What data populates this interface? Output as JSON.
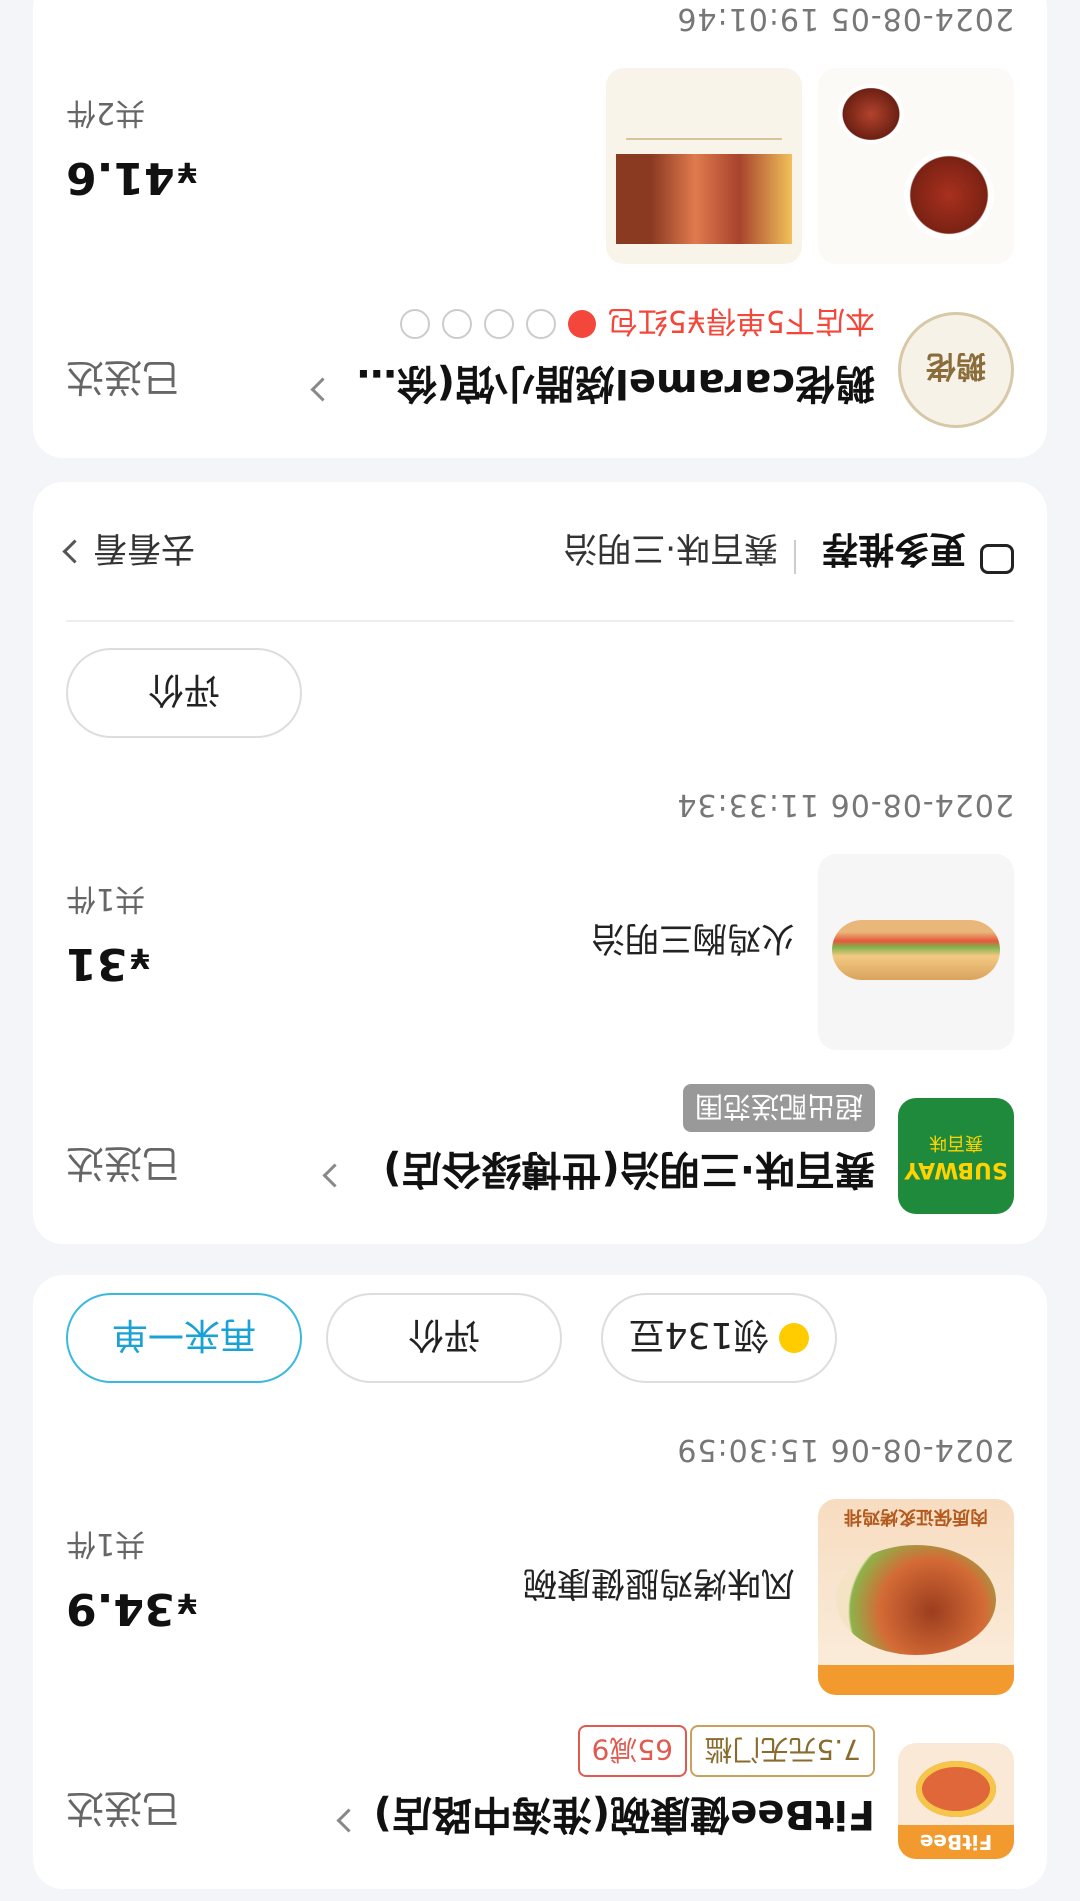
{
  "orders": [
    {
      "shop_name": "FitBee健康碗(淮海中路店)",
      "status": "已送达",
      "tags": [
        "7.5元无门槛",
        "65减9"
      ],
      "logo_text": "FitBee",
      "item_name": "风味烤鸡腿健康碗",
      "thumb_text": "肉质保证炙烤鸡排",
      "price_symbol": "¥",
      "price": "34.9",
      "count": "共1件",
      "time": "2024-08-06 15:30:59",
      "buttons": {
        "bean": "领134豆",
        "review": "评价",
        "reorder": "再来一单"
      }
    },
    {
      "shop_name": "赛百味·三明治(世博绿谷店)",
      "status": "已送达",
      "badge": "超出配送范围",
      "logo_text": "SUBWAY",
      "logo_sub": "赛百味",
      "item_name": "火鸡胸三明治",
      "price_symbol": "¥",
      "price": "31",
      "count": "共1件",
      "time": "2024-08-06 11:33:34",
      "buttons": {
        "review": "评价"
      },
      "recommend": {
        "title": "更多推荐",
        "shop": "赛百味·三明治",
        "link": "去看看"
      }
    },
    {
      "shop_name": "鹅佬caramel烧腊小馆(徐家…",
      "status": "已送达",
      "promo": "本店下5单得¥5红包",
      "logo_text": "鹅佬",
      "price_symbol": "¥",
      "price": "41.6",
      "count": "共2件",
      "time": "2024-08-05 19:01:46"
    }
  ],
  "colors": {
    "accent": "#1aa2d4",
    "promo_red": "#f2473a",
    "tag_orange": "#c9a15c",
    "tag_red": "#e05a50"
  }
}
